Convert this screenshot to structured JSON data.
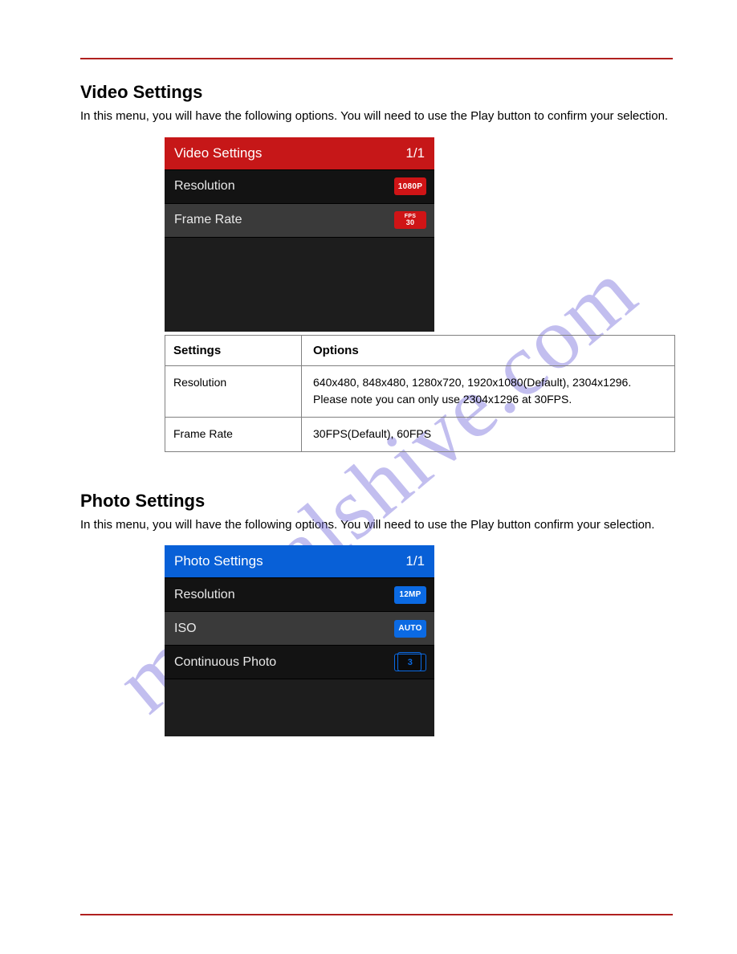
{
  "watermark": "manualshive.com",
  "video_section": {
    "title": "Video Settings",
    "intro": "In this menu, you will have the following options. You will need to use the Play button to confirm your selection.",
    "menu": {
      "header": "Video Settings",
      "page": "1/1",
      "rows": [
        {
          "label": "Resolution",
          "badge": "1080P",
          "badge_style": "red"
        },
        {
          "label": "Frame Rate",
          "badge_top": "FPS",
          "badge_bottom": "30",
          "badge_style": "stack"
        }
      ]
    },
    "table": {
      "head_left": "Settings",
      "head_right": "Options",
      "rows": [
        {
          "setting": "Resolution",
          "options": "640x480, 848x480, 1280x720, 1920x1080(Default), 2304x1296. Please note you can only use 2304x1296 at 30FPS."
        },
        {
          "setting": "Frame Rate",
          "options": "30FPS(Default), 60FPS"
        }
      ]
    }
  },
  "photo_section": {
    "title": "Photo Settings",
    "intro": "In this menu, you will have the following options. You will need to use the Play button confirm your selection.",
    "menu": {
      "header": "Photo Settings",
      "page": "1/1",
      "rows": [
        {
          "label": "Resolution",
          "badge": "12MP",
          "badge_style": "blue"
        },
        {
          "label": "ISO",
          "badge": "AUTO",
          "badge_style": "blue"
        },
        {
          "label": "Continuous Photo",
          "badge": "3",
          "badge_style": "outline-blue"
        }
      ]
    }
  }
}
